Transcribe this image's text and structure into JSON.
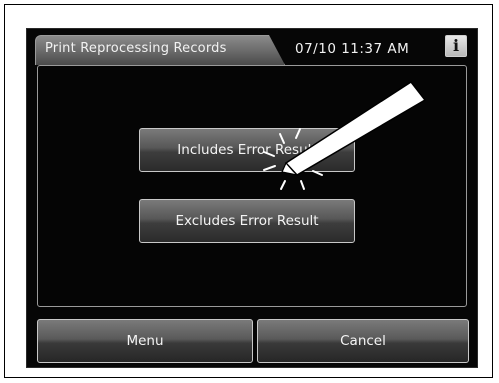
{
  "header": {
    "title": "Print Reprocessing Records",
    "datetime": "07/10 11:37 AM",
    "info_label": "i"
  },
  "options": {
    "includes_label": "Includes Error Result",
    "excludes_label": "Excludes Error Result"
  },
  "footer": {
    "menu_label": "Menu",
    "cancel_label": "Cancel"
  },
  "annotation": {
    "icon": "stylus-tap-icon"
  }
}
